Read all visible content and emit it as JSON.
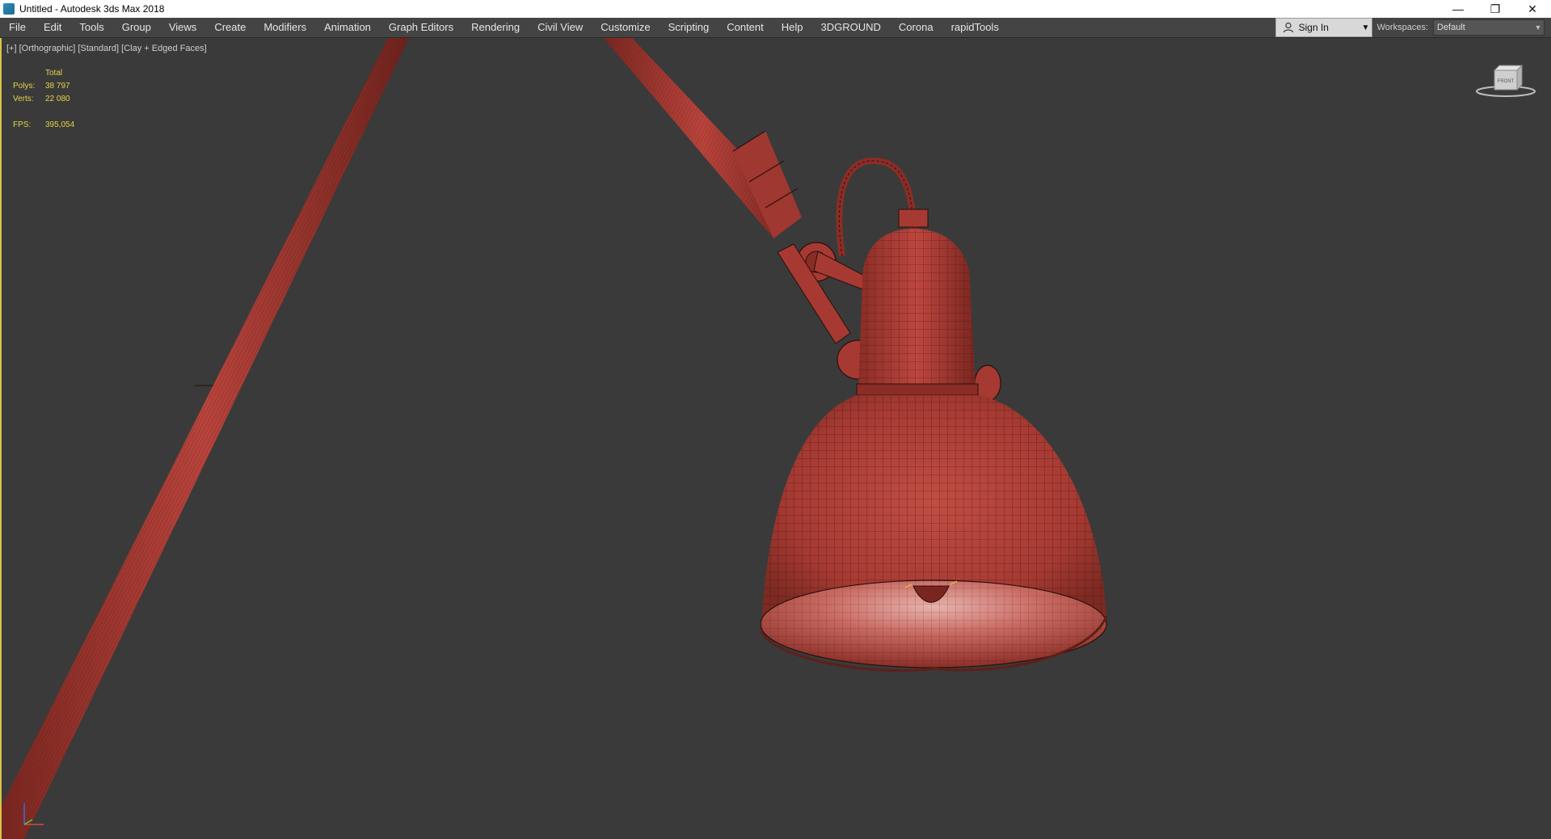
{
  "window": {
    "title": "Untitled - Autodesk 3ds Max 2018",
    "controls": [
      "minimize-icon",
      "restore-icon",
      "close-icon"
    ]
  },
  "menubar": {
    "items": [
      {
        "label": "File"
      },
      {
        "label": "Edit"
      },
      {
        "label": "Tools"
      },
      {
        "label": "Group"
      },
      {
        "label": "Views"
      },
      {
        "label": "Create"
      },
      {
        "label": "Modifiers"
      },
      {
        "label": "Animation"
      },
      {
        "label": "Graph Editors"
      },
      {
        "label": "Rendering"
      },
      {
        "label": "Civil View"
      },
      {
        "label": "Customize"
      },
      {
        "label": "Scripting"
      },
      {
        "label": "Content"
      },
      {
        "label": "Help"
      },
      {
        "label": "3DGROUND"
      },
      {
        "label": "Corona"
      },
      {
        "label": "rapidTools"
      }
    ],
    "signin_label": "Sign In",
    "workspaces_label": "Workspaces:",
    "workspace_value": "Default"
  },
  "viewport": {
    "label": "[+] [Orthographic] [Standard] [Clay + Edged Faces]",
    "stats": {
      "header": "Total",
      "polys_key": "Polys:",
      "polys_value": "38 797",
      "verts_key": "Verts:",
      "verts_value": "22 080",
      "fps_key": "FPS:",
      "fps_value": "395,054"
    },
    "model_color": "#b5413a",
    "wire_color": "#2a0f0c",
    "viewcube_label": "FRONT"
  }
}
